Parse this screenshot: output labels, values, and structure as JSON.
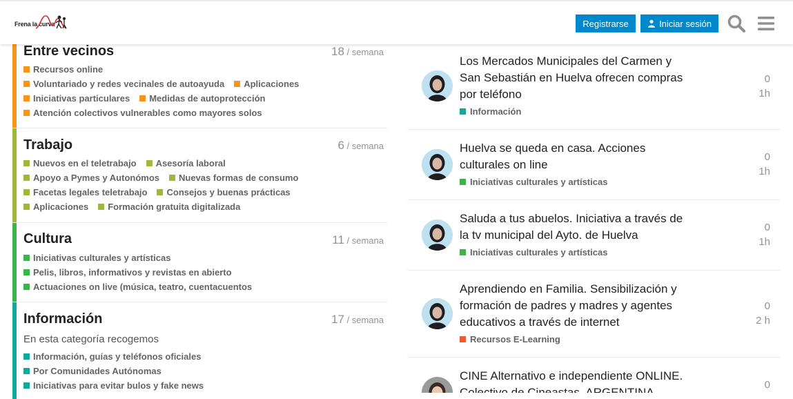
{
  "header": {
    "logo_text": "Frena la curva",
    "register_label": "Registrarse",
    "login_label": "Iniciar sesión",
    "icons": [
      "search-icon",
      "hamburger-menu-icon",
      "person-icon"
    ],
    "accent_color": "#0088cc"
  },
  "categories": [
    {
      "title": "Entre vecinos",
      "count": "18",
      "period": " / semana",
      "color": "#f7941d",
      "subcategories": [
        [
          {
            "label": "Recursos online",
            "color": "#f7941d"
          }
        ],
        [
          {
            "label": "Voluntariado y redes vecinales de autoayuda",
            "color": "#f7941d"
          },
          {
            "label": "Aplicaciones",
            "color": "#f7941d"
          }
        ],
        [
          {
            "label": "Iniciativas particulares",
            "color": "#f7941d"
          },
          {
            "label": "Medidas de autoprotección",
            "color": "#f7941d"
          }
        ],
        [
          {
            "label": "Atención colectivos vulnerables como mayores solos",
            "color": "#f7941d"
          }
        ]
      ]
    },
    {
      "title": "Trabajo",
      "count": "6",
      "period": " / semana",
      "color": "#9eb83b",
      "subcategories": [
        [
          {
            "label": "Nuevos en el teletrabajo",
            "color": "#9eb83b"
          },
          {
            "label": "Asesoría laboral",
            "color": "#9eb83b"
          }
        ],
        [
          {
            "label": "Apoyo a Pymes y Autonómos",
            "color": "#9eb83b"
          },
          {
            "label": "Nuevas formas de consumo",
            "color": "#9eb83b"
          }
        ],
        [
          {
            "label": "Facetas legales teletrabajo",
            "color": "#9eb83b"
          },
          {
            "label": "Consejos y buenas prácticas",
            "color": "#9eb83b"
          }
        ],
        [
          {
            "label": "Aplicaciones",
            "color": "#9eb83b"
          },
          {
            "label": "Formación gratuita digitalizada",
            "color": "#9eb83b"
          }
        ]
      ]
    },
    {
      "title": "Cultura",
      "count": "11",
      "period": " / semana",
      "color": "#3ab54a",
      "subcategories": [
        [
          {
            "label": "Iniciativas culturales y artísticas",
            "color": "#3ab54a"
          }
        ],
        [
          {
            "label": "Pelis, libros, informativos y revistas en abierto",
            "color": "#3ab54a"
          }
        ],
        [
          {
            "label": "Actuaciones on live (música, teatro, cuentacuentos",
            "color": "#3ab54a"
          }
        ]
      ]
    },
    {
      "title": "Información",
      "count": "17",
      "period": " / semana",
      "color": "#12a89d",
      "description": "En esta categoría recogemos",
      "subcategories": [
        [
          {
            "label": "Información, guías y teléfonos oficiales",
            "color": "#12a89d"
          }
        ],
        [
          {
            "label": "Por Comunidades Autónomas",
            "color": "#12a89d"
          }
        ],
        [
          {
            "label": "Iniciativas para evitar bulos y fake news",
            "color": "#12a89d"
          }
        ]
      ]
    }
  ],
  "topics": [
    {
      "title": "Los Mercados Municipales del Carmen y San Sebastián en Huelva ofrecen compras por teléfono",
      "category": "Información",
      "category_color": "#12a89d",
      "replies": "0",
      "age": "1h"
    },
    {
      "title": "Huelva se queda en casa. Acciones culturales on line",
      "category": "Iniciativas culturales y artísticas",
      "category_color": "#3ab54a",
      "replies": "0",
      "age": "1h"
    },
    {
      "title": "Saluda a tus abuelos. Iniciativa a través de la tv municipal del Ayto. de Huelva",
      "category": "Iniciativas culturales y artísticas",
      "category_color": "#3ab54a",
      "replies": "0",
      "age": "1h"
    },
    {
      "title": "Aprendiendo en Familia. Sensibilización y formación de padres y madres y agentes educativos a través de internet",
      "category": "Recursos E-Learning",
      "category_color": "#f1592a",
      "replies": "0",
      "age": "2 h"
    },
    {
      "title": "CINE Alternativo e independiente ONLINE. Colectivo de Cineastas. ARGENTINA",
      "replies": "0"
    }
  ]
}
